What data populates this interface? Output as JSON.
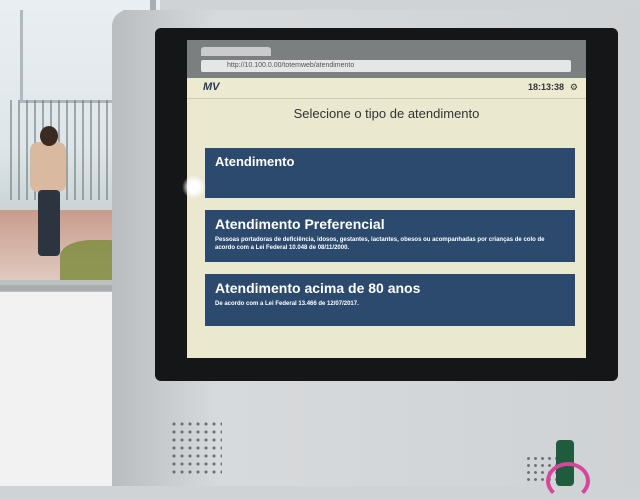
{
  "browser": {
    "url": "http://10.100.0.00/totemweb/atendimento"
  },
  "header": {
    "logo": "MV",
    "time": "18:13:38",
    "icons": [
      "menu-icon",
      "settings-icon"
    ]
  },
  "prompt": "Selecione o tipo de atendimento",
  "options": [
    {
      "title": "Atendimento",
      "description": ""
    },
    {
      "title": "Atendimento Preferencial",
      "description": "Pessoas portadoras de deficiência, idosos, gestantes, lactantes, obesos ou acompanhadas por crianças de colo de acordo com a Lei Federal 10.048 de 08/11/2000."
    },
    {
      "title": "Atendimento acima de 80 anos",
      "description": "De acordo com a Lei Federal 13.466 de 12/07/2017."
    }
  ],
  "colors": {
    "button_bg": "#2c4a6e",
    "screen_bg": "#eae9cf",
    "text_on_button": "#ffffff"
  }
}
